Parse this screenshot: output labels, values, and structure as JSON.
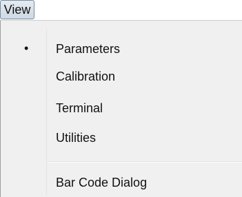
{
  "menu_bar": {
    "view_label": "View"
  },
  "view_menu": {
    "selected_indicator": "•",
    "items": [
      {
        "label": "Parameters",
        "selected": true
      },
      {
        "label": "Calibration",
        "selected": false
      },
      {
        "label": "Terminal",
        "selected": false
      },
      {
        "label": "Utilities",
        "selected": false
      },
      {
        "label": "Bar Code Dialog",
        "selected": false
      }
    ]
  }
}
